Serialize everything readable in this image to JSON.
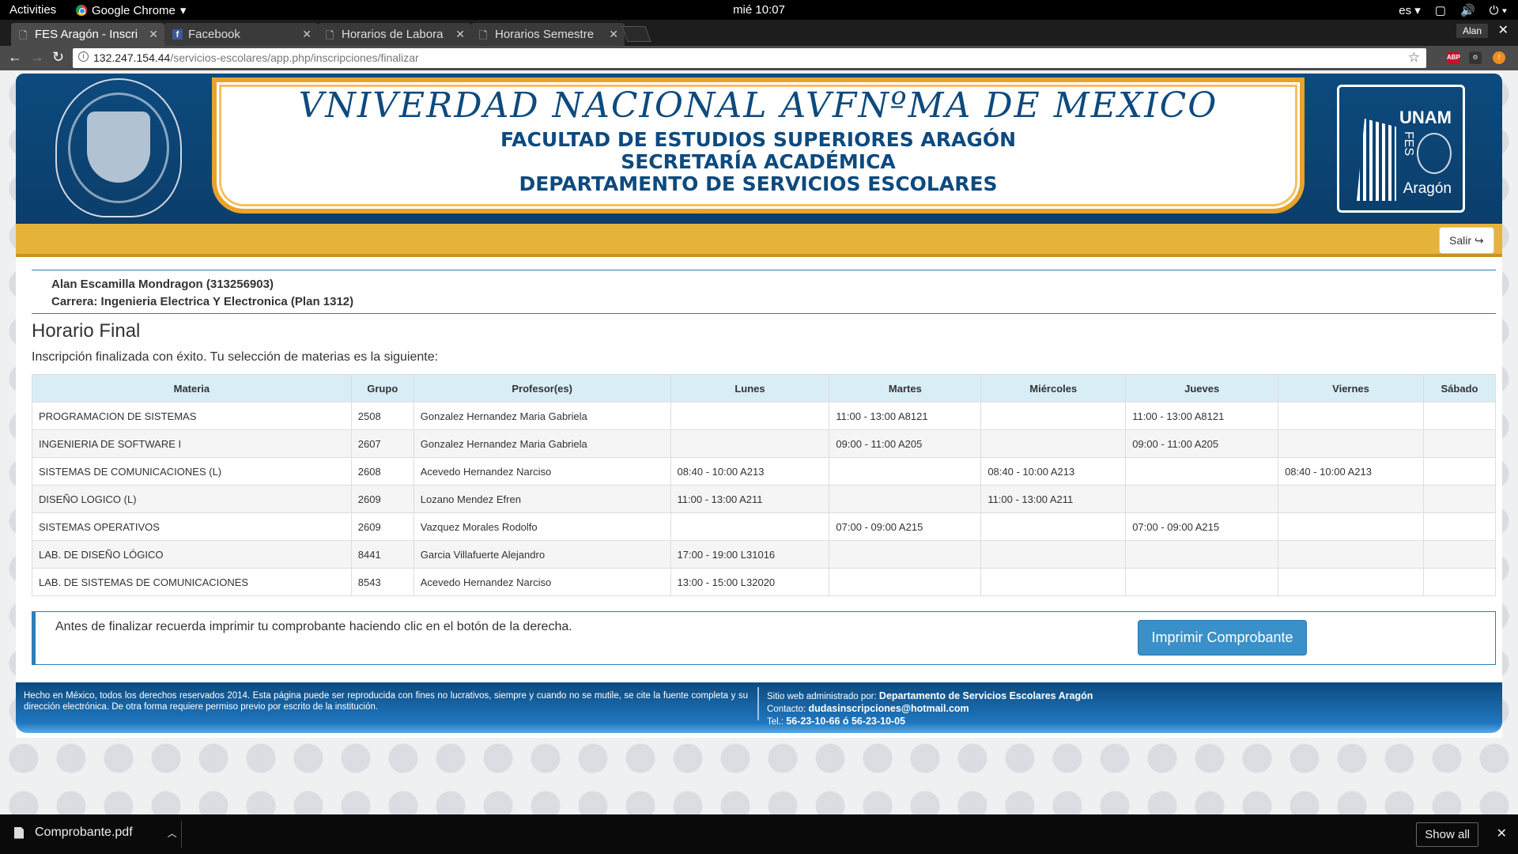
{
  "os": {
    "activities": "Activities",
    "app_name": "Google Chrome",
    "clock": "mié 10:07",
    "lang": "es"
  },
  "browser": {
    "tabs": [
      {
        "label": "FES Aragón - Inscri",
        "active": true
      },
      {
        "label": "Facebook",
        "active": false
      },
      {
        "label": "Horarios de Labora",
        "active": false
      },
      {
        "label": "Horarios Semestre",
        "active": false
      }
    ],
    "profile": "Alan",
    "url_host": "132.247.154.44",
    "url_path": "/servicios-escolares/app.php/inscripciones/finalizar",
    "ext_abp": "ABP"
  },
  "header": {
    "university": "VNIVERDAD NACIONAL AVFNºMA DE MEXICO",
    "faculty": "FACULTAD DE ESTUDIOS SUPERIORES ARAGÓN",
    "secretariat": "SECRETARÍA ACADÉMICA",
    "department": "DEPARTAMENTO DE SERVICIOS ESCOLARES",
    "logo_unam": "UNAM",
    "logo_fes": "FES",
    "logo_aragon": "Aragón",
    "logout_label": "Salir"
  },
  "student": {
    "name_line": "Alan Escamilla Mondragon (313256903)",
    "career_line": "Carrera: Ingenieria Electrica Y Electronica (Plan 1312)"
  },
  "schedule": {
    "title": "Horario Final",
    "subtitle": "Inscripción finalizada con éxito. Tu selección de materias es la siguiente:",
    "columns": [
      "Materia",
      "Grupo",
      "Profesor(es)",
      "Lunes",
      "Martes",
      "Miércoles",
      "Jueves",
      "Viernes",
      "Sábado"
    ],
    "rows": [
      [
        "PROGRAMACION DE SISTEMAS",
        "2508",
        "Gonzalez Hernandez Maria Gabriela",
        "",
        "11:00 - 13:00 A8121",
        "",
        "11:00 - 13:00 A8121",
        "",
        ""
      ],
      [
        "INGENIERIA DE SOFTWARE I",
        "2607",
        "Gonzalez Hernandez Maria Gabriela",
        "",
        "09:00 - 11:00 A205",
        "",
        "09:00 - 11:00 A205",
        "",
        ""
      ],
      [
        "SISTEMAS DE COMUNICACIONES (L)",
        "2608",
        "Acevedo Hernandez Narciso",
        "08:40 - 10:00 A213",
        "",
        "08:40 - 10:00 A213",
        "",
        "08:40 - 10:00 A213",
        ""
      ],
      [
        "DISEÑO LOGICO (L)",
        "2609",
        "Lozano Mendez Efren",
        "11:00 - 13:00 A211",
        "",
        "11:00 - 13:00 A211",
        "",
        "",
        ""
      ],
      [
        "SISTEMAS OPERATIVOS",
        "2609",
        "Vazquez Morales Rodolfo",
        "",
        "07:00 - 09:00 A215",
        "",
        "07:00 - 09:00 A215",
        "",
        ""
      ],
      [
        "LAB. DE DISEÑO LÓGICO",
        "8441",
        "Garcia Villafuerte Alejandro",
        "17:00 - 19:00 L31016",
        "",
        "",
        "",
        "",
        ""
      ],
      [
        "LAB. DE SISTEMAS DE COMUNICACIONES",
        "8543",
        "Acevedo Hernandez Narciso",
        "13:00 - 15:00 L32020",
        "",
        "",
        "",
        "",
        ""
      ]
    ]
  },
  "notice": {
    "text": "Antes de finalizar recuerda imprimir tu comprobante haciendo clic en el botón de la derecha.",
    "print_label": "Imprimir Comprobante"
  },
  "footer": {
    "legal": "Hecho en México, todos los derechos reservados 2014. Esta página puede ser reproducida con fines no lucrativos, siempre y cuando no se mutile, se cite la fuente completa y su dirección electrónica. De otra forma requiere permiso previo por escrito de la institución.",
    "admin_label": "Sitio web administrado por:",
    "admin_value": "Departamento de Servicios Escolares Aragón",
    "contact_label": "Contacto:",
    "contact_value": "dudasinscripciones@hotmail.com",
    "phone_label": "Tel.:",
    "phone_value": "56-23-10-66 ó 56-23-10-05"
  },
  "downloads": {
    "file": "Comprobante.pdf",
    "show_all": "Show all"
  },
  "colors": {
    "brand_blue": "#0d4a7e",
    "gold": "#e6b33a",
    "table_header": "#d9edf7",
    "button": "#3a90c8"
  }
}
